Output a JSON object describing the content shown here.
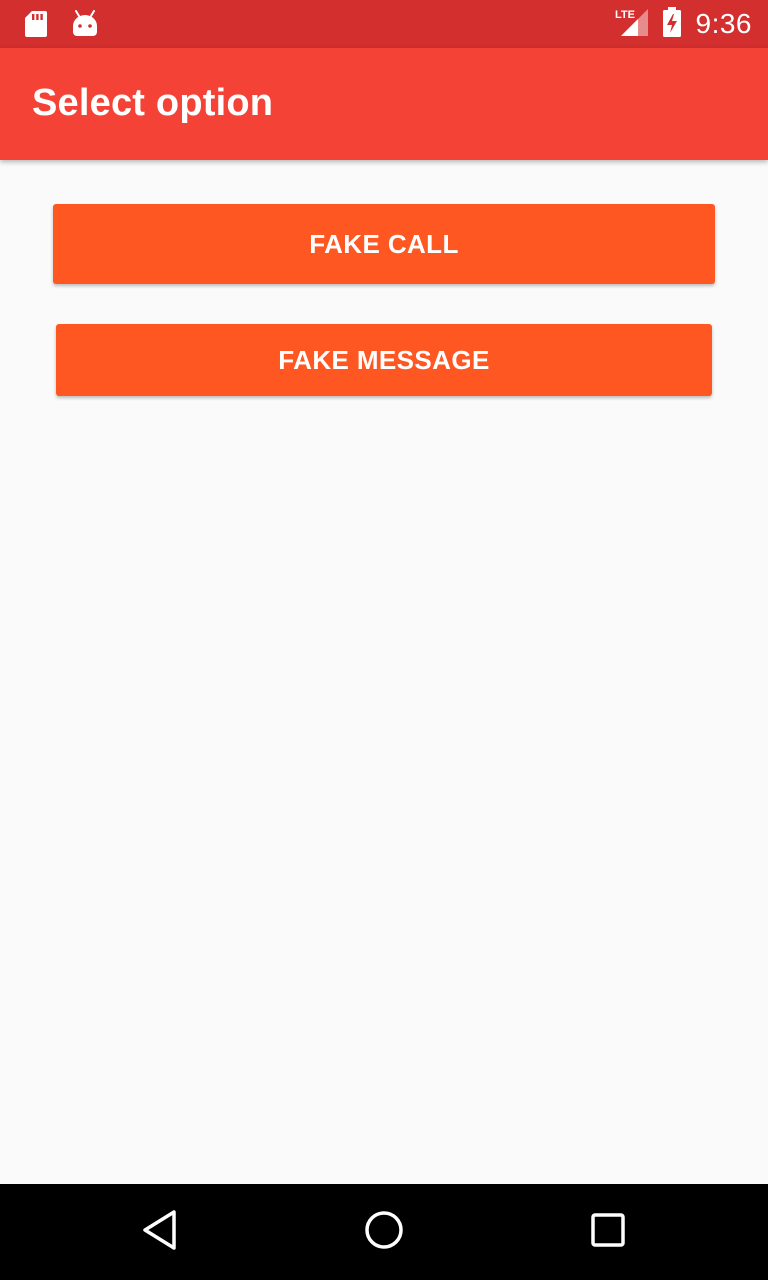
{
  "status_bar": {
    "left_icons": [
      "sd-card-icon",
      "android-icon"
    ],
    "network_label": "LTE",
    "right_icons": [
      "lte-signal-icon",
      "battery-charging-icon"
    ],
    "time": "9:36",
    "color": "#d32f2f"
  },
  "app_bar": {
    "title": "Select option",
    "color": "#f44336"
  },
  "main": {
    "buttons": [
      {
        "label": "FAKE CALL"
      },
      {
        "label": "FAKE MESSAGE"
      }
    ],
    "button_color": "#ff5722",
    "background": "#fafafa"
  },
  "nav_bar": {
    "buttons": [
      "back-icon",
      "home-icon",
      "recents-icon"
    ],
    "color": "#000000"
  }
}
